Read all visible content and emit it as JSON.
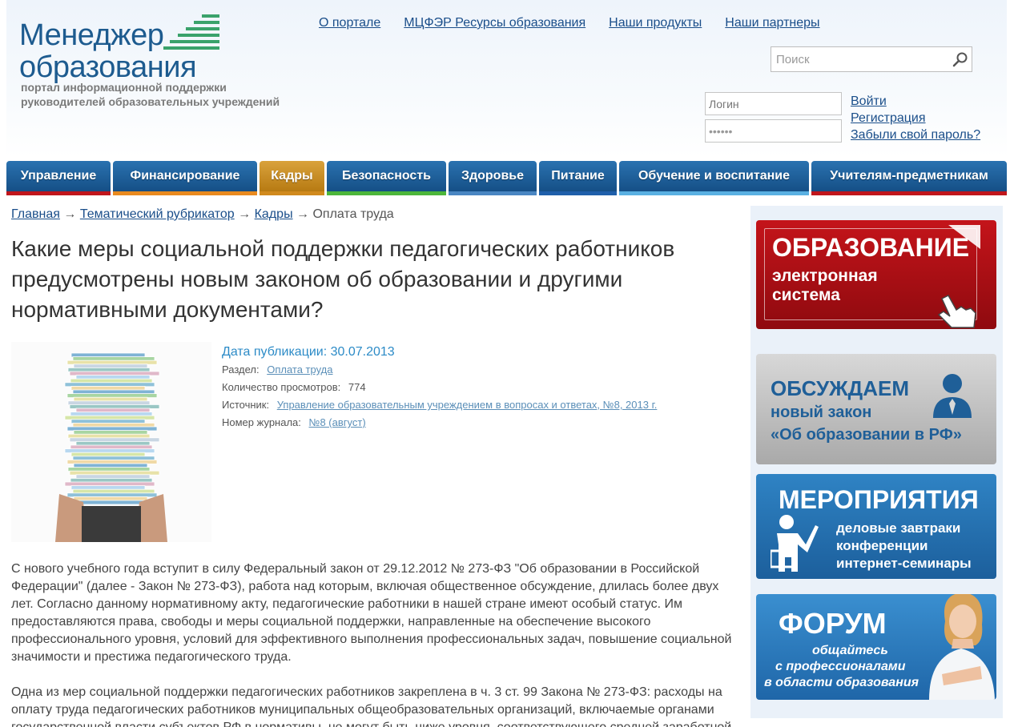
{
  "logo": {
    "title_line1": "Менеджер",
    "title_line2": "образования",
    "tagline_line1": "портал информационной поддержки",
    "tagline_line2": "руководителей образовательных учреждений"
  },
  "top_links": [
    "О портале",
    "МЦФЭР Ресурсы образования",
    "Наши продукты",
    "Наши партнеры"
  ],
  "search": {
    "placeholder": "Поиск"
  },
  "login": {
    "login_placeholder": "Логин",
    "password_value": "••••••",
    "links": [
      "Войти",
      "Регистрация",
      "Забыли свой пароль?"
    ]
  },
  "nav": [
    {
      "label": "Управление",
      "color": "#c0161c",
      "width": 130,
      "active": false
    },
    {
      "label": "Финансирование",
      "color": "#e98a1f",
      "width": 180,
      "active": false
    },
    {
      "label": "Кадры",
      "color": "#d18a1d",
      "width": 81,
      "active": true
    },
    {
      "label": "Безопасность",
      "color": "#4cb63a",
      "width": 149,
      "active": false
    },
    {
      "label": "Здоровье",
      "color": "#4a86c2",
      "width": 110,
      "active": false
    },
    {
      "label": "Питание",
      "color": "#1f5faa",
      "width": 97,
      "active": false
    },
    {
      "label": "Обучение и воспитание",
      "color": "#5ab0e2",
      "width": 237,
      "active": false
    },
    {
      "label": "Учителям-предметникам",
      "color": "#c0161c",
      "width": 244,
      "active": false
    }
  ],
  "breadcrumb": {
    "links": [
      "Главная",
      "Тематический рубрикатор",
      "Кадры"
    ],
    "separator": "→",
    "current": "Оплата труда"
  },
  "page_title": "Какие меры социальной поддержки педагогических работников предусмотрены новым законом об образовании и другими нормативными документами?",
  "meta": {
    "pub_date": "Дата публикации: 30.07.2013",
    "section_label": "Раздел:",
    "section_value": "Оплата труда",
    "views_label": "Количество просмотров:",
    "views_value": "774",
    "source_label": "Источник:",
    "source_value": "Управление образовательным учреждением в вопросах и ответах, №8, 2013 г.",
    "issue_label": "Номер журнала:",
    "issue_value": "№8 (август)"
  },
  "body": {
    "p1": "С нового учебного года вступит в силу Федеральный закон от 29.12.2012 № 273-ФЗ \"Об образовании в Российской Федерации\" (далее - Закон № 273-ФЗ), работа над которым, включая общественное обсуждение, длилась более двух лет. Согласно данному нормативному акту, педагогические работники в нашей стране имеют особый статус. Им предоставляются права, свободы и меры социальной поддержки, направленные на обеспечение высокого профессионального уровня, условий для эффективного выполнения профессиональных задач, повышение социальной значимости и престижа педагогического труда.",
    "p2": "Одна из мер социальной поддержки педагогических работников закреплена в ч. 3 ст. 99 Закона № 273-ФЗ: расходы на оплату труда педагогических работников муниципальных общеобразовательных организаций, включаемые органами государственной власти субъектов РФ в нормативы, не могут быть ниже уровня, соответствующего средней заработной"
  },
  "banners": {
    "b1_title": "ОБРАЗОВАНИЕ",
    "b1_sub1": "электронная",
    "b1_sub2": "система",
    "b2_title": "ОБСУЖДАЕМ",
    "b2_sub1": "новый закон",
    "b2_sub2": "«Об образовании в РФ»",
    "b3_title": "МЕРОПРИЯТИЯ",
    "b3_sub1": "деловые завтраки",
    "b3_sub2": "конференции",
    "b3_sub3": "интернет-семинары",
    "b4_title": "ФОРУМ",
    "b4_sub1": "общайтесь",
    "b4_sub2": "с профессионалами",
    "b4_sub3": "в области образования"
  }
}
